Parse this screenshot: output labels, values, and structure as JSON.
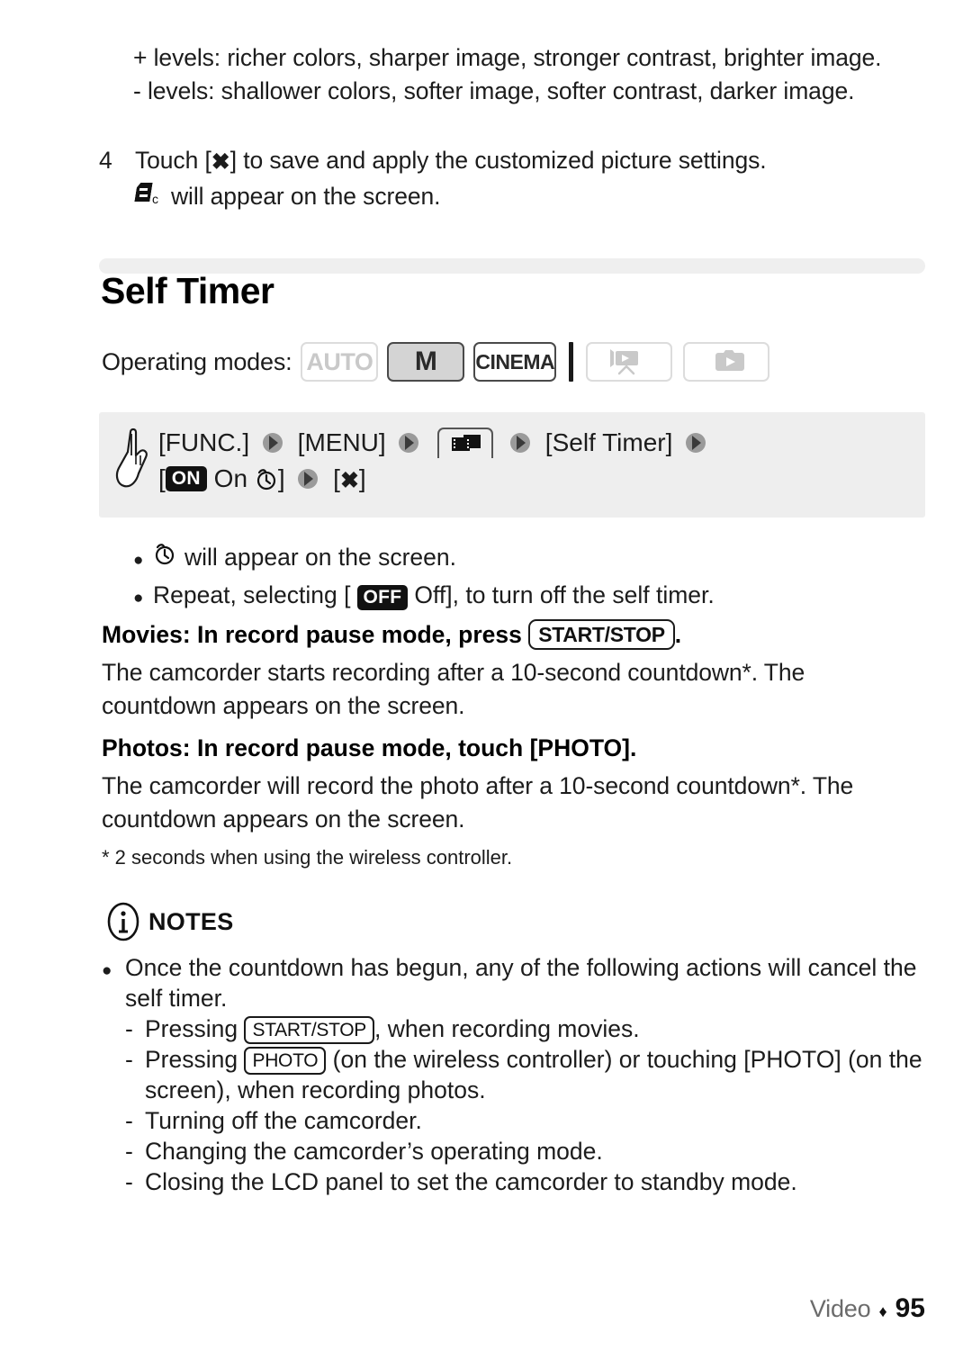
{
  "continuation": {
    "plus_levels": "+ levels: richer colors, sharper image, stronger contrast, brighter image.",
    "minus_levels": "- levels: shallower colors, softer image, softer contrast, darker image."
  },
  "step": {
    "number": "4",
    "text_before_icon": "Touch [",
    "icon_glyph": "✖",
    "text_after_icon": "] to save and apply the customized picture settings.",
    "sub_text": "will appear on the screen.",
    "sub_icon_subscript": "c"
  },
  "section": {
    "title": "Self Timer"
  },
  "operating_modes": {
    "label": "Operating modes:",
    "badges": [
      {
        "name": "auto",
        "label": "AUTO",
        "state": "off"
      },
      {
        "name": "manual",
        "label": "M",
        "state": "on-filled"
      },
      {
        "name": "cinema",
        "label": "CINEMA",
        "state": "on"
      }
    ],
    "playback_icons": [
      {
        "name": "movie-playback",
        "state": "off"
      },
      {
        "name": "photo-playback",
        "state": "off"
      }
    ]
  },
  "menu_path": {
    "func": "[FUNC.]",
    "menu": "[MENU]",
    "self_timer": "[Self Timer]",
    "on_badge": "ON",
    "on_label": "On",
    "close_open": "[",
    "close_glyph": "✖",
    "close_close": "]"
  },
  "bullets": [
    {
      "icon": "self-timer-glyph",
      "text": "will appear on the screen."
    },
    {
      "text_before": "Repeat, selecting [",
      "badge": "OFF",
      "text_mid": "Off], to turn off the self timer."
    }
  ],
  "movies": {
    "lead_before": "Movies: In record pause mode, press",
    "key": "START/STOP",
    "lead_after": ".",
    "paragraph": "The camcorder starts recording after a 10-second countdown*. The countdown appears on the screen."
  },
  "photos": {
    "lead": "Photos: In record pause mode, touch [PHOTO].",
    "paragraph": "The camcorder will record the photo after a 10-second countdown*. The countdown appears on the screen."
  },
  "footnote": "* 2 seconds when using the wireless controller.",
  "notes": {
    "heading": "NOTES",
    "main_bullet": "Once the countdown has begun, any of the following actions will cancel the self timer.",
    "items": [
      {
        "before": "Pressing",
        "key": "START/STOP",
        "after": ", when recording movies."
      },
      {
        "before": "Pressing",
        "key": "PHOTO",
        "after": "(on the wireless controller) or touching [PHOTO] (on the screen), when recording photos."
      },
      {
        "before": "Turning off the camcorder.",
        "key": "",
        "after": ""
      },
      {
        "before": "Changing the camcorder’s operating mode.",
        "key": "",
        "after": ""
      },
      {
        "before": "Closing the LCD panel to set the camcorder to standby mode.",
        "key": "",
        "after": ""
      }
    ]
  },
  "footer": {
    "section": "Video",
    "diamond": "♦",
    "page": "95"
  }
}
